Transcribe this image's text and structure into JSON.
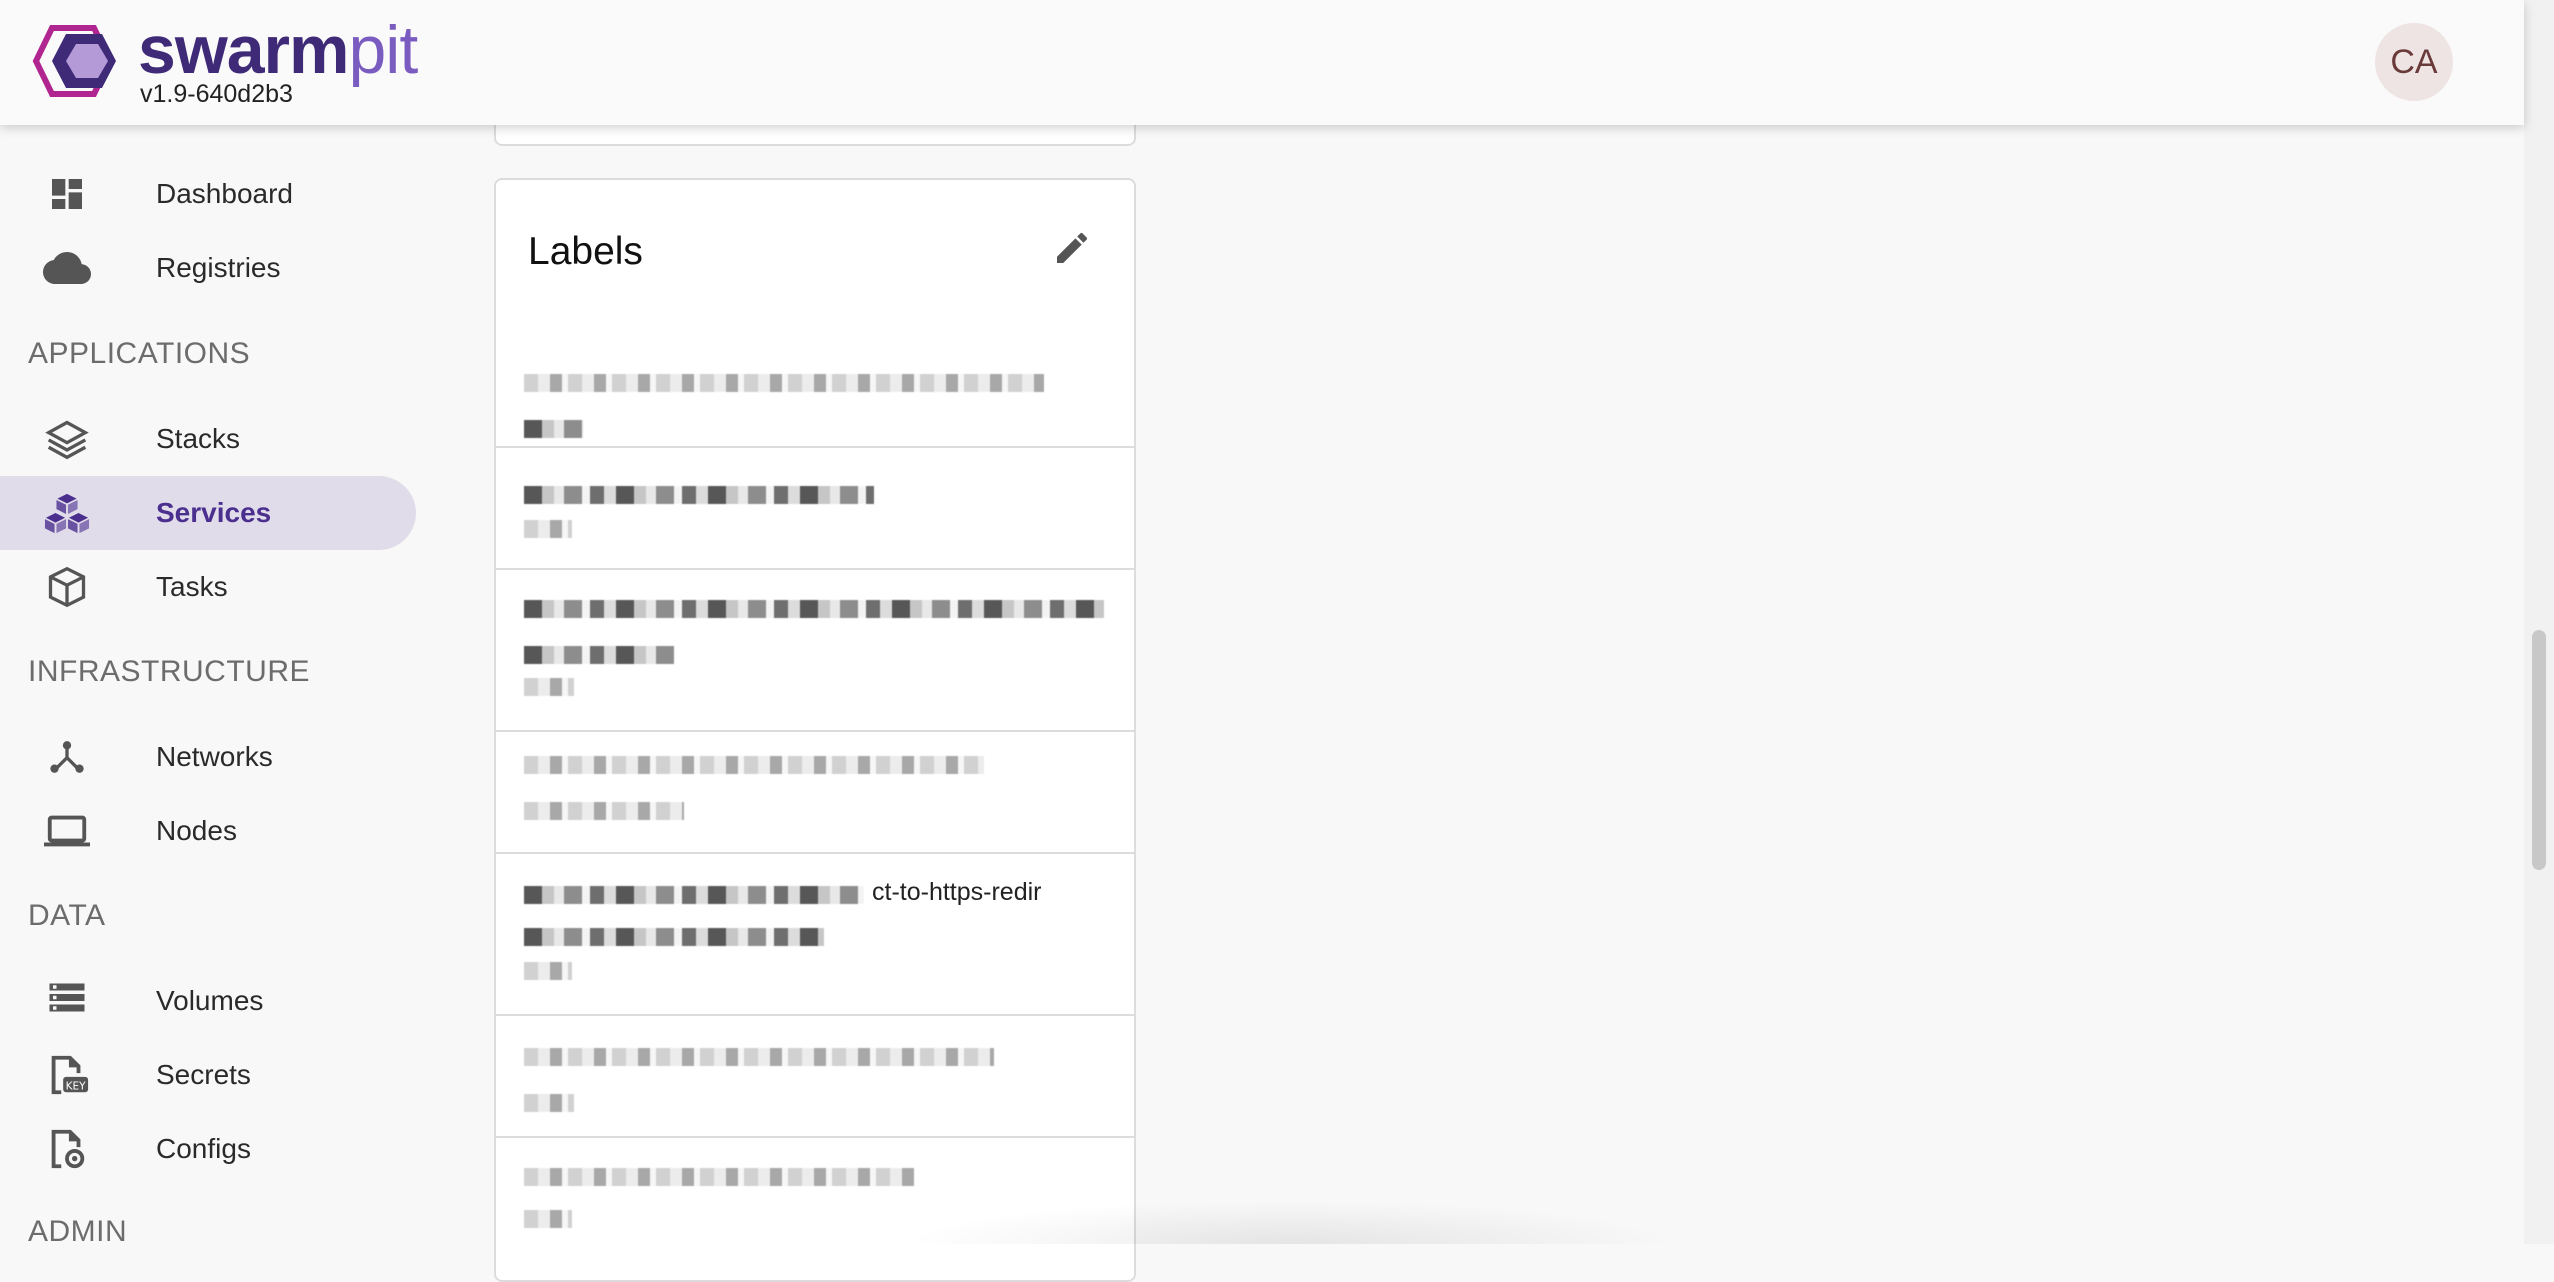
{
  "header": {
    "brand_prefix": "swarm",
    "brand_suffix": "pit",
    "version": "v1.9-640d2b3",
    "avatar_initials": "CA"
  },
  "sidebar": {
    "items_top": [
      {
        "label": "Dashboard",
        "icon": "dashboard-icon"
      },
      {
        "label": "Registries",
        "icon": "cloud-icon"
      }
    ],
    "sections": [
      {
        "title": "APPLICATIONS",
        "items": [
          {
            "label": "Stacks",
            "icon": "layers-icon"
          },
          {
            "label": "Services",
            "icon": "services-icon",
            "active": true
          },
          {
            "label": "Tasks",
            "icon": "cube-icon"
          }
        ]
      },
      {
        "title": "INFRASTRUCTURE",
        "items": [
          {
            "label": "Networks",
            "icon": "network-icon"
          },
          {
            "label": "Nodes",
            "icon": "laptop-icon"
          }
        ]
      },
      {
        "title": "DATA",
        "items": [
          {
            "label": "Volumes",
            "icon": "storage-icon"
          },
          {
            "label": "Secrets",
            "icon": "key-file-icon"
          },
          {
            "label": "Configs",
            "icon": "settings-file-icon"
          }
        ]
      },
      {
        "title": "ADMIN",
        "items": []
      }
    ]
  },
  "labels_card": {
    "title": "Labels",
    "edit_icon": "pencil-icon",
    "visible_row_text": "ct-to-https-redir"
  },
  "colors": {
    "brand_dark": "#3f2a78",
    "brand_light": "#7a5cc0",
    "active_bg": "#e1dcea",
    "active_text": "#4b2f8f"
  }
}
